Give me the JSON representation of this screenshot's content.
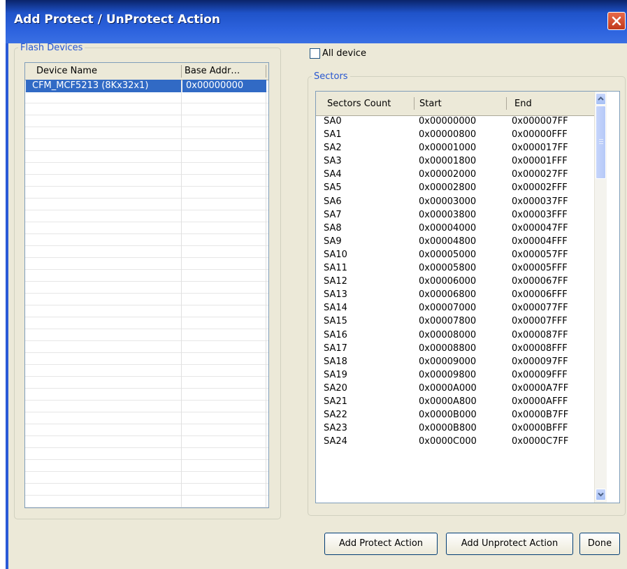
{
  "window": {
    "title": "Add Protect / UnProtect Action"
  },
  "flash_devices": {
    "legend": "Flash Devices",
    "columns": [
      "Device Name",
      "Base Addr…"
    ],
    "rows": [
      {
        "name": "CFM_MCF5213 (8Kx32x1)",
        "base": "0x00000000",
        "selected": true
      }
    ]
  },
  "all_device": {
    "label": "All device",
    "checked": false
  },
  "sectors": {
    "legend": "Sectors",
    "columns": [
      "Sectors Count",
      "Start",
      "End"
    ],
    "rows": [
      [
        "SA0",
        "0x00000000",
        "0x000007FF"
      ],
      [
        "SA1",
        "0x00000800",
        "0x00000FFF"
      ],
      [
        "SA2",
        "0x00001000",
        "0x000017FF"
      ],
      [
        "SA3",
        "0x00001800",
        "0x00001FFF"
      ],
      [
        "SA4",
        "0x00002000",
        "0x000027FF"
      ],
      [
        "SA5",
        "0x00002800",
        "0x00002FFF"
      ],
      [
        "SA6",
        "0x00003000",
        "0x000037FF"
      ],
      [
        "SA7",
        "0x00003800",
        "0x00003FFF"
      ],
      [
        "SA8",
        "0x00004000",
        "0x000047FF"
      ],
      [
        "SA9",
        "0x00004800",
        "0x00004FFF"
      ],
      [
        "SA10",
        "0x00005000",
        "0x000057FF"
      ],
      [
        "SA11",
        "0x00005800",
        "0x00005FFF"
      ],
      [
        "SA12",
        "0x00006000",
        "0x000067FF"
      ],
      [
        "SA13",
        "0x00006800",
        "0x00006FFF"
      ],
      [
        "SA14",
        "0x00007000",
        "0x000077FF"
      ],
      [
        "SA15",
        "0x00007800",
        "0x00007FFF"
      ],
      [
        "SA16",
        "0x00008000",
        "0x000087FF"
      ],
      [
        "SA17",
        "0x00008800",
        "0x00008FFF"
      ],
      [
        "SA18",
        "0x00009000",
        "0x000097FF"
      ],
      [
        "SA19",
        "0x00009800",
        "0x00009FFF"
      ],
      [
        "SA20",
        "0x0000A000",
        "0x0000A7FF"
      ],
      [
        "SA21",
        "0x0000A800",
        "0x0000AFFF"
      ],
      [
        "SA22",
        "0x0000B000",
        "0x0000B7FF"
      ],
      [
        "SA23",
        "0x0000B800",
        "0x0000BFFF"
      ],
      [
        "SA24",
        "0x0000C000",
        "0x0000C7FF"
      ]
    ]
  },
  "buttons": {
    "add_protect": "Add Protect Action",
    "add_unprotect": "Add Unprotect Action",
    "done": "Done"
  },
  "colors": {
    "selection": "#316ac5",
    "titlebar": "#2d63de",
    "legend_text": "#2756d0"
  }
}
